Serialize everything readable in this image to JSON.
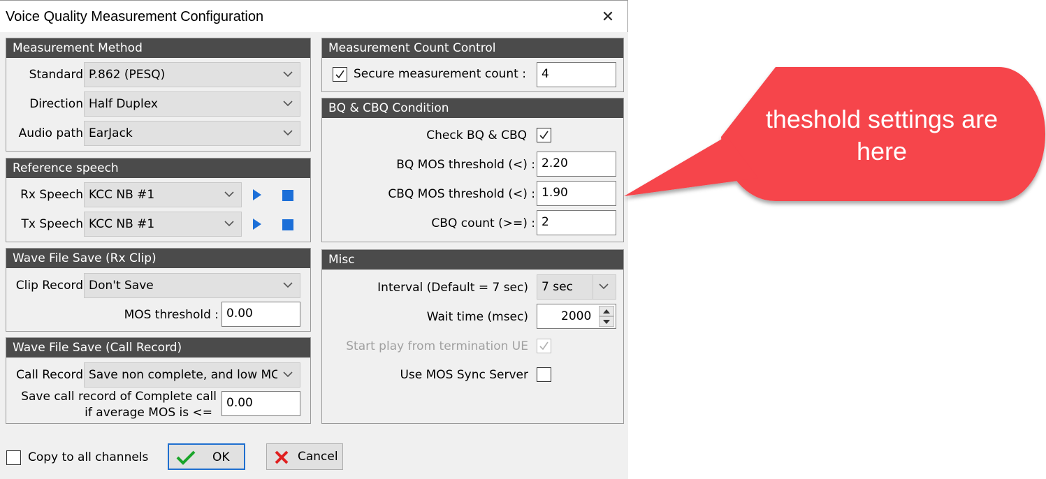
{
  "window": {
    "title": "Voice Quality Measurement Configuration",
    "close_glyph": "✕"
  },
  "measurement_method": {
    "header": "Measurement Method",
    "standard_label": "Standard",
    "standard_value": "P.862 (PESQ)",
    "direction_label": "Direction",
    "direction_value": "Half Duplex",
    "audio_path_label": "Audio path",
    "audio_path_value": "EarJack"
  },
  "reference_speech": {
    "header": "Reference speech",
    "rx_label": "Rx Speech",
    "rx_value": "KCC NB #1",
    "tx_label": "Tx Speech",
    "tx_value": "KCC NB #1"
  },
  "wave_rx_clip": {
    "header": "Wave File Save (Rx Clip)",
    "clip_record_label": "Clip Record",
    "clip_record_value": "Don't Save",
    "mos_threshold_label": "MOS threshold :",
    "mos_threshold_value": "0.00"
  },
  "wave_call_record": {
    "header": "Wave File Save (Call Record)",
    "call_record_label": "Call Record",
    "call_record_value": "Save non complete, and low MC",
    "save_complete_line1": "Save call record of Complete call",
    "save_complete_line2": "if average MOS is <=",
    "save_complete_value": "0.00"
  },
  "count_control": {
    "header": "Measurement Count Control",
    "secure_label": "Secure measurement count :",
    "secure_checked": true,
    "secure_value": "4"
  },
  "bq_cbq": {
    "header": "BQ & CBQ Condition",
    "check_label": "Check BQ & CBQ",
    "check_checked": true,
    "bq_label": "BQ MOS threshold (<) :",
    "bq_value": "2.20",
    "cbq_label": "CBQ MOS threshold (<) :",
    "cbq_value": "1.90",
    "cbq_count_label": "CBQ count (>=) :",
    "cbq_count_value": "2"
  },
  "misc": {
    "header": "Misc",
    "interval_label": "Interval (Default = 7 sec)",
    "interval_value": "7 sec",
    "wait_label": "Wait time (msec)",
    "wait_value": "2000",
    "start_play_label": "Start play from termination UE",
    "start_play_checked": true,
    "start_play_disabled": true,
    "sync_label": "Use MOS Sync Server",
    "sync_checked": false
  },
  "footer": {
    "copy_label": "Copy to all channels",
    "copy_checked": false,
    "ok_label": "OK",
    "cancel_label": "Cancel"
  },
  "callout": {
    "line1": "theshold settings are",
    "line2": "here",
    "color": "#f6444c"
  }
}
